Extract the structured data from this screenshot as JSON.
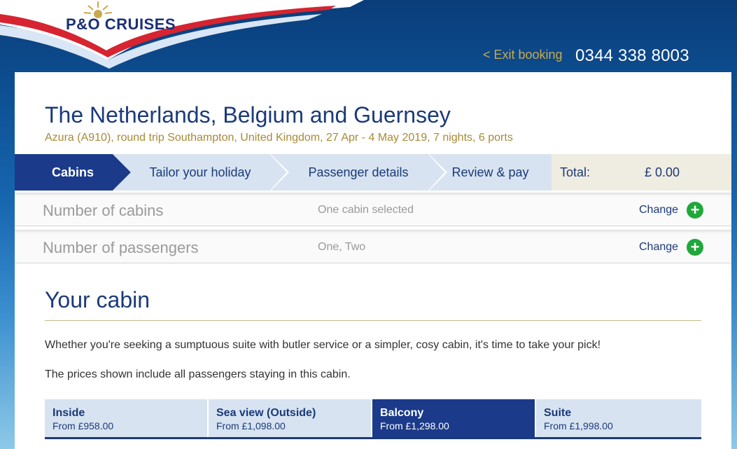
{
  "brand": {
    "logo_text": "P&O CRUISES"
  },
  "header": {
    "exit_label": "< Exit booking",
    "phone": "0344 338 8003"
  },
  "trip": {
    "title": "The Netherlands, Belgium and Guernsey",
    "subtitle": "Azura (A910), round trip Southampton, United Kingdom, 27 Apr - 4 May 2019, 7 nights, 6 ports"
  },
  "steps": [
    {
      "label": "Cabins",
      "active": true
    },
    {
      "label": "Tailor your holiday",
      "active": false
    },
    {
      "label": "Passenger details",
      "active": false
    },
    {
      "label": "Review & pay",
      "active": false
    }
  ],
  "total": {
    "label": "Total:",
    "value": "£ 0.00"
  },
  "selections": [
    {
      "name": "Number of cabins",
      "value": "One cabin selected",
      "action": "Change"
    },
    {
      "name": "Number of passengers",
      "value": "One, Two",
      "action": "Change"
    }
  ],
  "cabin": {
    "title": "Your cabin",
    "intro": "Whether you're seeking a sumptuous suite with butler service or a simpler, cosy cabin, it's time to take your pick!",
    "note": "The prices shown include all passengers staying in this cabin.",
    "tabs": [
      {
        "name": "Inside",
        "price": "From £958.00",
        "active": false
      },
      {
        "name": "Sea view (Outside)",
        "price": "From £1,098.00",
        "active": false
      },
      {
        "name": "Balcony",
        "price": "From £1,298.00",
        "active": true
      },
      {
        "name": "Suite",
        "price": "From £1,998.00",
        "active": false
      }
    ]
  },
  "colors": {
    "brand_navy": "#1b3a7a",
    "gold": "#a88a36",
    "add_green": "#1fa83a",
    "active_tab": "#1b3a8a"
  }
}
